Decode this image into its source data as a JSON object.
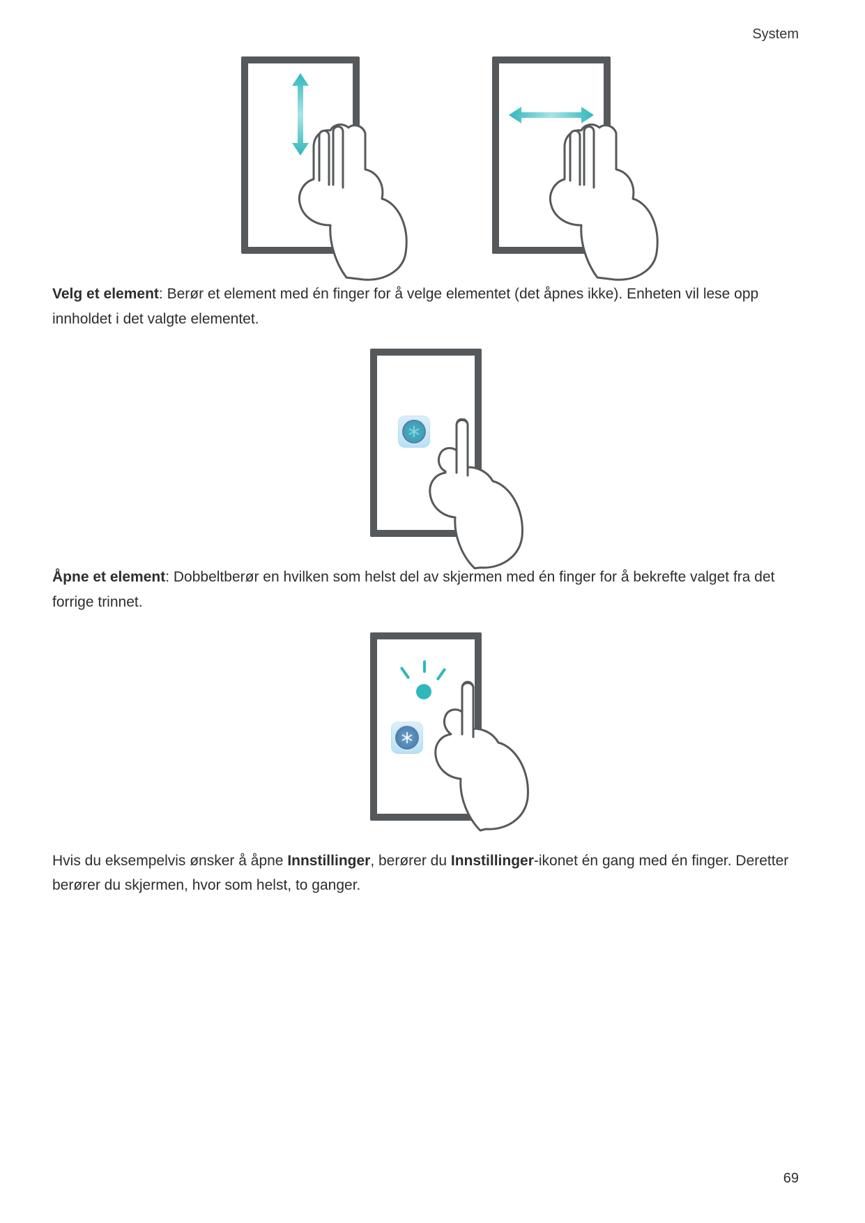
{
  "header": {
    "section_label": "System"
  },
  "page_number": "69",
  "colors": {
    "teal": "#2fb8bc",
    "frame_gray": "#56595b"
  },
  "figures": {
    "fig1": {
      "name": "two-finger-swipe-vertical-icon"
    },
    "fig2": {
      "name": "two-finger-swipe-horizontal-icon"
    },
    "fig3": {
      "name": "single-tap-select-icon"
    },
    "fig4": {
      "name": "double-tap-open-icon"
    }
  },
  "paragraphs": {
    "p1": {
      "bold": "Velg et element",
      "rest": ": Berør et element med én finger for å velge elementet (det åpnes ikke). Enheten vil lese opp innholdet i det valgte elementet."
    },
    "p2": {
      "bold": "Åpne et element",
      "rest": ": Dobbeltberør en hvilken som helst del av skjermen med én finger for å bekrefte valget fra det forrige trinnet."
    },
    "p3": {
      "pre": "Hvis du eksempelvis ønsker å åpne ",
      "bold1": "Innstillinger",
      "mid": ", berører du ",
      "bold2": "Innstillinger",
      "post": "-ikonet én gang med én finger. Deretter berører du skjermen, hvor som helst, to ganger."
    }
  }
}
